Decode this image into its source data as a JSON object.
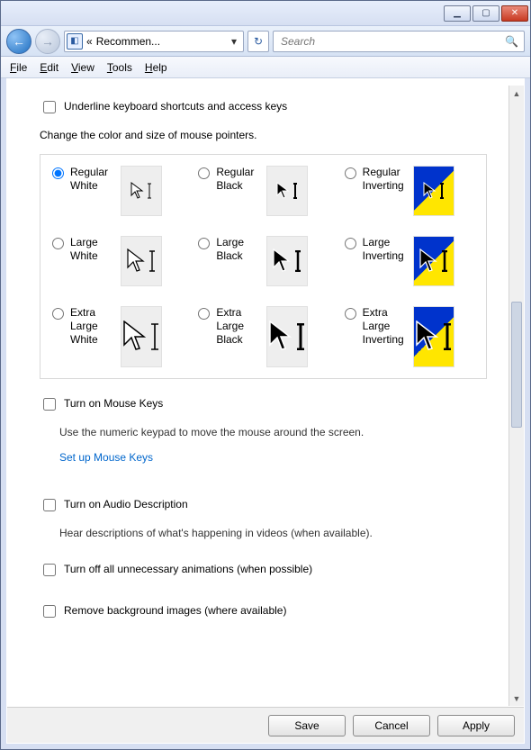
{
  "window": {
    "breadcrumb_prefix": "«",
    "breadcrumb_text": "Recommen...",
    "search_placeholder": "Search"
  },
  "menu": {
    "file": "File",
    "edit": "Edit",
    "view": "View",
    "tools": "Tools",
    "help": "Help"
  },
  "underline_kb": "Underline keyboard shortcuts and access keys",
  "pointer_heading": "Change the color and size of mouse pointers.",
  "pointers": {
    "reg_white": "Regular White",
    "reg_black": "Regular Black",
    "reg_inv": "Regular Inverting",
    "lg_white": "Large White",
    "lg_black": "Large Black",
    "lg_inv": "Large Inverting",
    "xl_white": "Extra Large White",
    "xl_black": "Extra Large Black",
    "xl_inv": "Extra Large Inverting"
  },
  "mouse_keys_check": "Turn on Mouse Keys",
  "mouse_keys_desc": "Use the numeric keypad to move the mouse around the screen.",
  "mouse_keys_link": "Set up Mouse Keys",
  "audio_desc_check": "Turn on Audio Description",
  "audio_desc_desc": "Hear descriptions of what's happening in videos (when available).",
  "turn_off_anim": "Turn off all unnecessary animations (when possible)",
  "remove_bg": "Remove background images (where available)",
  "buttons": {
    "save": "Save",
    "cancel": "Cancel",
    "apply": "Apply"
  }
}
